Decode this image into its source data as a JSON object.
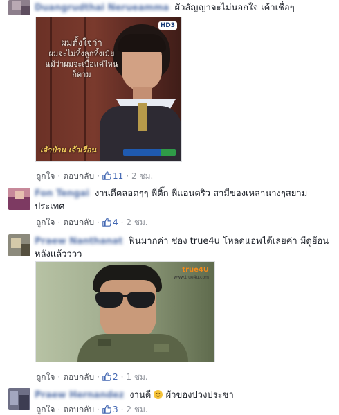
{
  "comments": [
    {
      "user": "Duangrudthai Nerueamma",
      "text": "ผัวสัญญาจะไม่นอกใจ เค้าเชื่อๆ",
      "image": {
        "caption_line1": "ผมตั้งใจว่า",
        "caption_line2": "ผมจะไม่ทิ้งลูกทิ้งเมีย",
        "caption_line3": "แม้ว่าผมจะเบื่อแค่ไหน",
        "caption_line4": "ก็ตาม",
        "channel_logo": "HD3",
        "show_title": "เจ้าบ้าน เจ้าเรือน"
      },
      "actions": {
        "like": "ถูกใจ",
        "reply": "ตอบกลับ",
        "like_count": "11",
        "time": "2 ชม."
      }
    },
    {
      "user": "Fon Tengai",
      "text": "งานดีตลอดๆๆ พี่ติ๊ก พี่แอนดริว สามีของเหล่านางๆสยามประเทศ",
      "actions": {
        "like": "ถูกใจ",
        "reply": "ตอบกลับ",
        "like_count": "4",
        "time": "2 ชม."
      }
    },
    {
      "user": "Praew Nanthanat",
      "text": "ฟินมากค่า ช่อง true4u โหลดแอพได้เลยค่า มีดูย้อนหลังแล้วววว",
      "image": {
        "channel_logo": "true4U",
        "site": "www.true4u.com"
      },
      "actions": {
        "like": "ถูกใจ",
        "reply": "ตอบกลับ",
        "like_count": "2",
        "time": "1 ชม."
      }
    },
    {
      "user": "Praew Hernandez",
      "text_before": "งานดี",
      "text_after": "ผัวของปวงประชา",
      "emoji": "smiley-emoji",
      "actions": {
        "like": "ถูกใจ",
        "reply": "ตอบกลับ",
        "like_count": "3",
        "time": "2 ชม."
      }
    }
  ],
  "colors": {
    "link": "#365899",
    "like_blue": "#4267b2",
    "meta_gray": "#90949c",
    "text": "#1d2129"
  }
}
